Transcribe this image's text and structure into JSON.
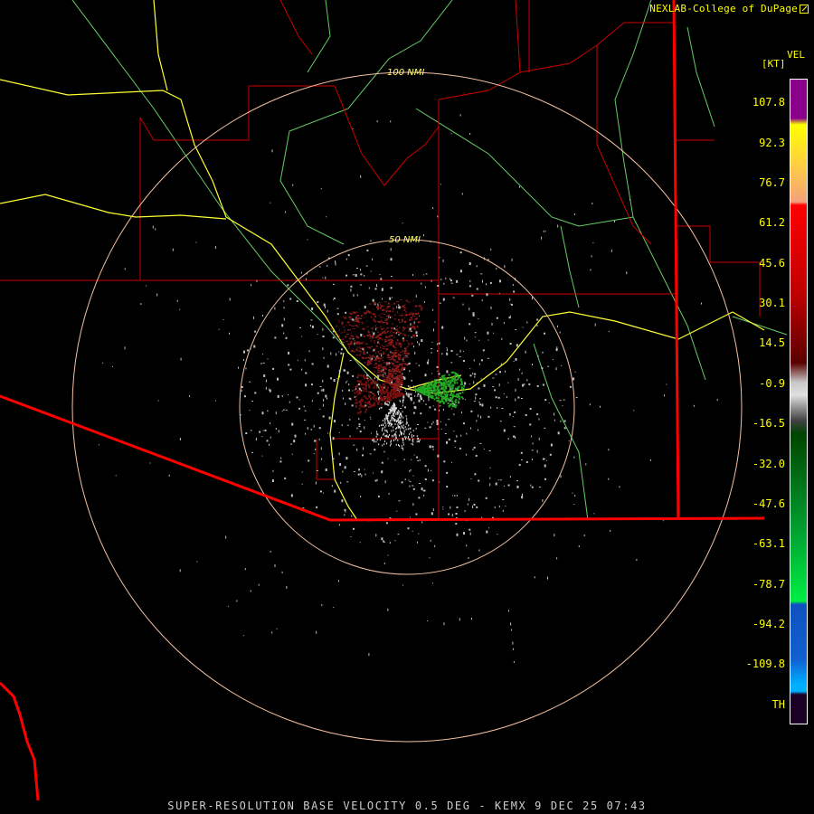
{
  "header": {
    "credit": "NEXLAB-College of DuPage",
    "credit_icon": "external-link-icon"
  },
  "footer": {
    "caption": "SUPER-RESOLUTION BASE VELOCITY 0.5 DEG - KEMX 9 DEC 25 07:43"
  },
  "range_rings": [
    {
      "label": "100 NMI"
    },
    {
      "label": "50 NMI"
    }
  ],
  "legend": {
    "title": "VEL",
    "unit": "[KT]",
    "ticks": [
      "107.8",
      "92.3",
      "76.7",
      "61.2",
      "45.6",
      "30.1",
      "14.5",
      "-0.9",
      "-16.5",
      "-32.0",
      "-47.6",
      "-63.1",
      "-78.7",
      "-94.2",
      "-109.8",
      "TH"
    ],
    "colors": {
      "purple": "#8b008b",
      "yellow": "#ffff00",
      "peach": "#f4a07a",
      "red": "#ff0000",
      "dark_red": "#5a0000",
      "gray": "#c8c8c8",
      "dark_green": "#004400",
      "green": "#00ee44",
      "blue": "#1050c0",
      "cyan": "#00b0ff",
      "background": "#1a0022"
    }
  },
  "map_colors": {
    "state_border": "#ff0000",
    "county_border": "#cc0000",
    "highway": "#ffff33",
    "river": "#66dd66",
    "range_ring": "#f4c0a0",
    "echo_outbound": "#8b1a1a",
    "echo_inbound": "#22aa22",
    "echo_clutter": "#bfbfbf"
  }
}
